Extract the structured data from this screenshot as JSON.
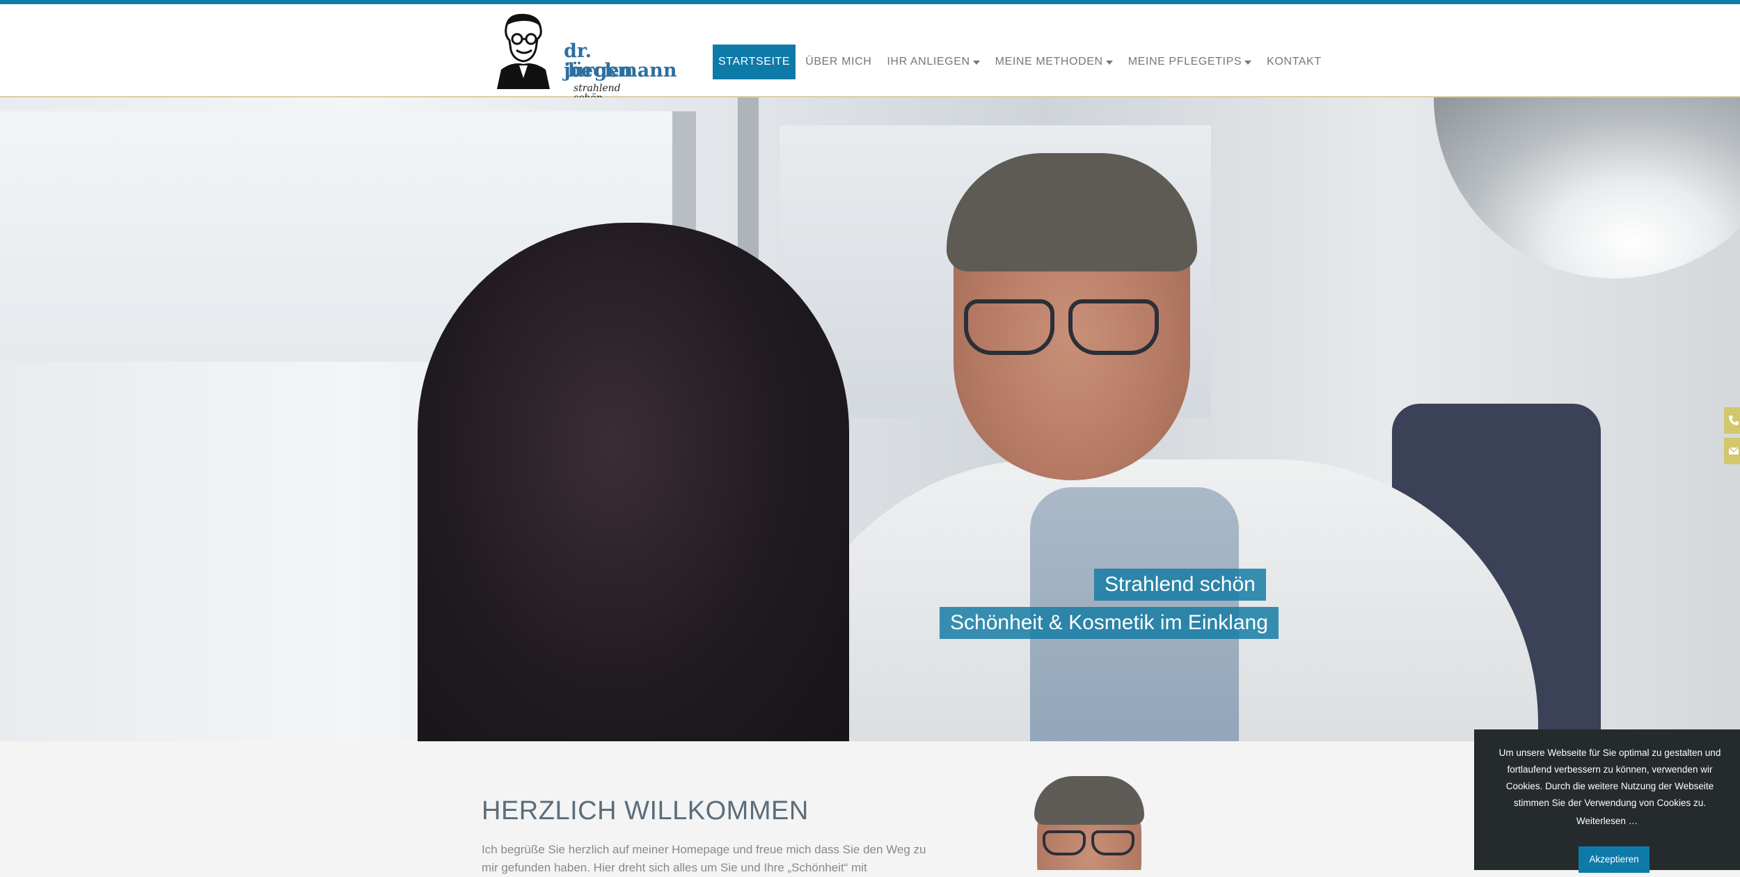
{
  "logo": {
    "name_line1": "dr. jürgen",
    "name_line2": "beckmann",
    "tagline": "strahlend schön"
  },
  "nav": {
    "items": [
      {
        "label": "STARTSEITE",
        "active": true,
        "dropdown": false
      },
      {
        "label": "ÜBER MICH",
        "active": false,
        "dropdown": false
      },
      {
        "label": "IHR ANLIEGEN",
        "active": false,
        "dropdown": true
      },
      {
        "label": "MEINE METHODEN",
        "active": false,
        "dropdown": true
      },
      {
        "label": "MEINE PFLEGETIPS",
        "active": false,
        "dropdown": true
      },
      {
        "label": "KONTAKT",
        "active": false,
        "dropdown": false
      }
    ]
  },
  "hero": {
    "slogan_line1": "Strahlend schön",
    "slogan_line2": "Schönheit & Kosmetik im Einklang"
  },
  "side_contact": {
    "icons": [
      "phone-icon",
      "envelope-icon"
    ]
  },
  "welcome": {
    "heading": "HERZLICH WILLKOMMEN",
    "intro": "Ich begrüße Sie herzlich auf meiner Homepage und freue mich dass Sie den Weg zu mir gefunden haben. Hier dreht sich alles um Sie und Ihre „Schönheit“ mit"
  },
  "cookie": {
    "text": "Um unsere Webseite für Sie optimal zu gestalten und fortlaufend verbessern zu können, verwenden wir Cookies. Durch die weitere Nutzung der Webseite stimmen Sie der Verwendung von Cookies zu.",
    "more_link": "Weiterlesen …",
    "accept_button": "Akzeptieren"
  },
  "colors": {
    "accent": "#0e7aa8",
    "side_tab": "#d2c76a",
    "cookie_bg": "#252a2c",
    "heading": "#5a6d7c"
  }
}
